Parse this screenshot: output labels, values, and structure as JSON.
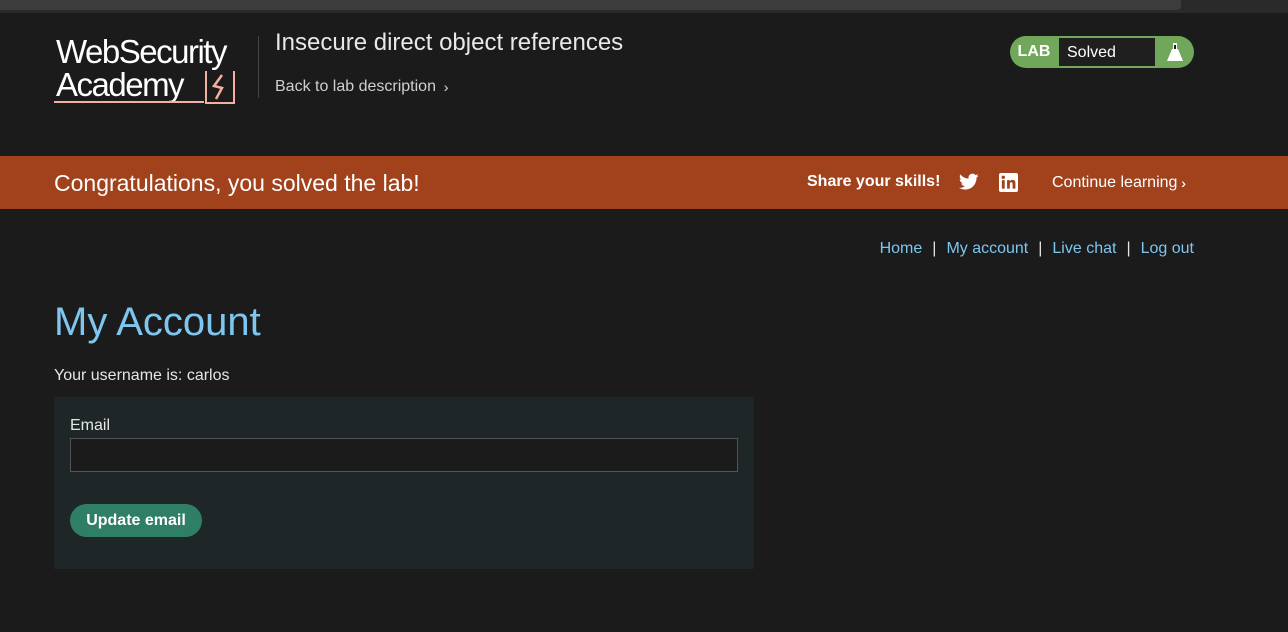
{
  "logo": {
    "line1": "WebSecurity",
    "line2": "Academy"
  },
  "header": {
    "lab_title": "Insecure direct object references",
    "back_link": "Back to lab description",
    "lab_badge": "LAB",
    "status": "Solved"
  },
  "banner": {
    "message": "Congratulations, you solved the lab!",
    "share_label": "Share your skills!",
    "continue_label": "Continue learning",
    "icons": [
      "twitter-icon",
      "linkedin-icon"
    ]
  },
  "nav": {
    "items": [
      {
        "label": "Home"
      },
      {
        "label": "My account"
      },
      {
        "label": "Live chat"
      },
      {
        "label": "Log out"
      }
    ],
    "separator": "|"
  },
  "main": {
    "title": "My Account",
    "username_line": "Your username is: carlos",
    "email_label": "Email",
    "email_value": "",
    "update_button": "Update email"
  },
  "colors": {
    "banner": "#a1421d",
    "accent_link": "#7ec6f0",
    "status_green": "#70a75a",
    "button_green": "#2f7e66"
  }
}
